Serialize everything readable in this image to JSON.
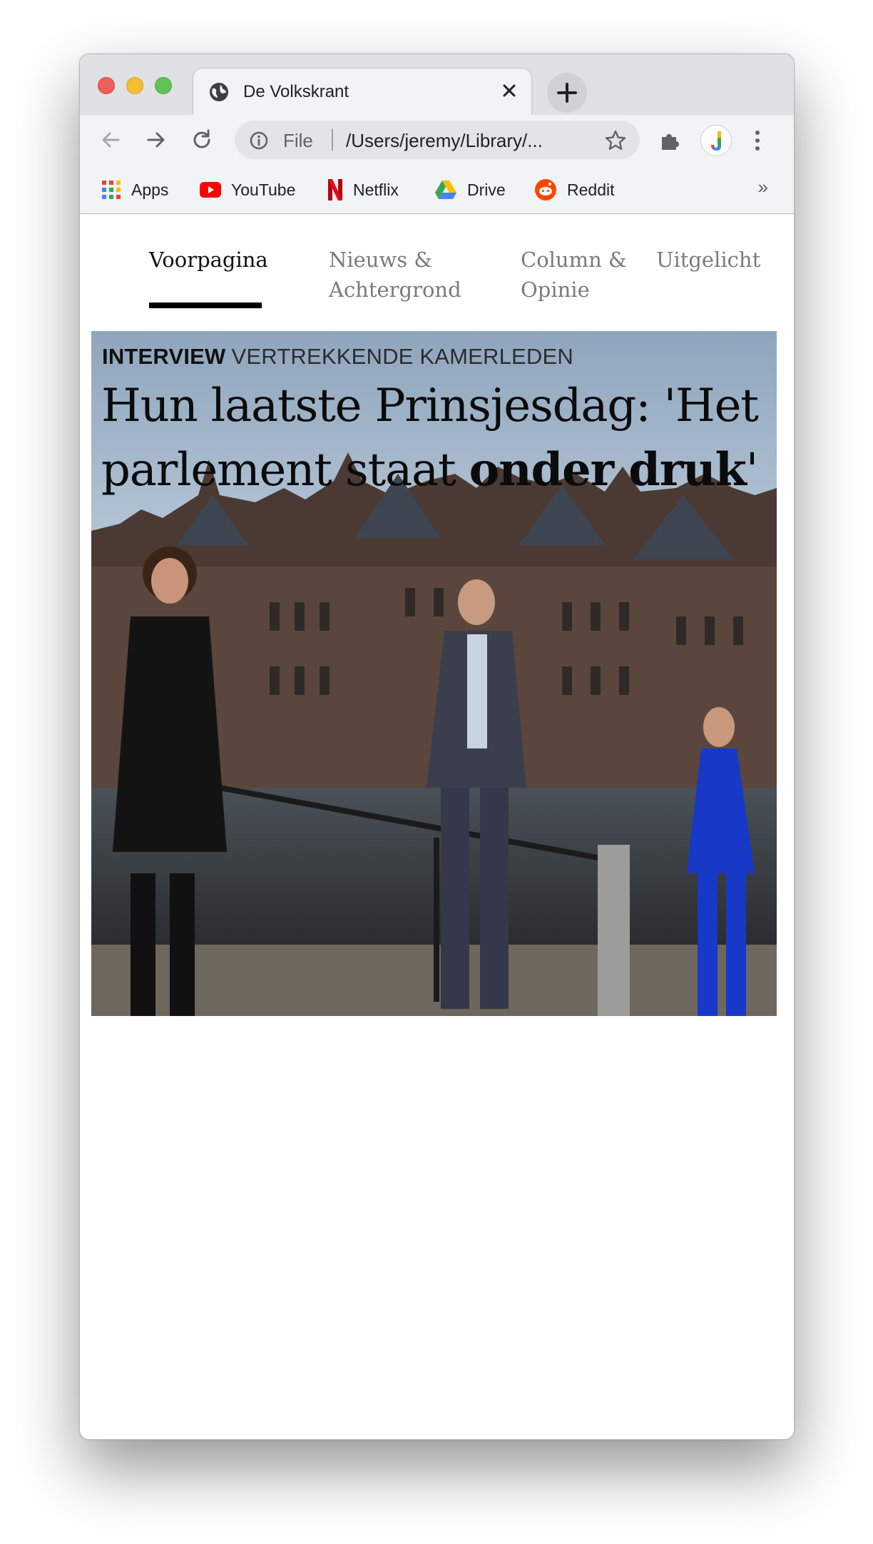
{
  "browser": {
    "tab_title": "De Volkskrant",
    "omnibox_scheme": "File",
    "omnibox_url": "/Users/jeremy/Library/...",
    "bookmarks": [
      {
        "label": "Apps",
        "icon": "apps-grid-icon"
      },
      {
        "label": "YouTube",
        "icon": "youtube-icon"
      },
      {
        "label": "Netflix",
        "icon": "netflix-icon"
      },
      {
        "label": "Drive",
        "icon": "google-drive-icon"
      },
      {
        "label": "Reddit",
        "icon": "reddit-icon"
      }
    ],
    "bookmarks_overflow": "»",
    "new_tab_label": "+"
  },
  "site_nav": {
    "items": [
      {
        "label": "Voorpagina",
        "active": true
      },
      {
        "label": "Nieuws & Achtergrond",
        "active": false
      },
      {
        "label": "Column & Opinie",
        "active": false
      },
      {
        "label": "Uitgelicht",
        "active": false
      }
    ]
  },
  "hero": {
    "kicker_bold": "INTERVIEW",
    "kicker_rest": "VERTREKKENDE KAMERLEDEN",
    "headline_regular": "Hun laatste Prinsjesdag: 'Het parlement staat ",
    "headline_bold": "onder druk",
    "headline_end": "'"
  },
  "colors": {
    "chrome_bg": "#dfe1e5",
    "toolbar_bg": "#f1f3f4",
    "active_underline": "#000000",
    "inactive_nav": "#7b7b7b"
  }
}
